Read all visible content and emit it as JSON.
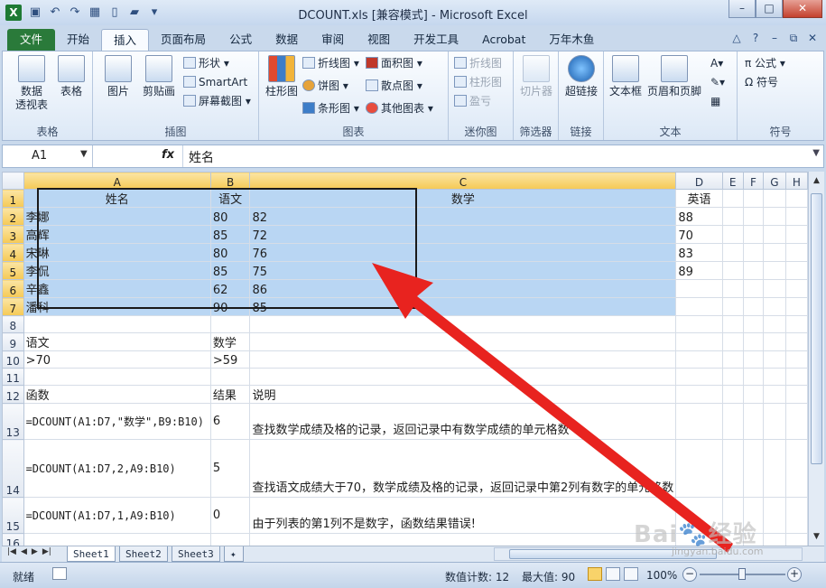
{
  "window": {
    "title": "DCOUNT.xls  [兼容模式] - Microsoft Excel",
    "app_icon": "X"
  },
  "quick_access": {
    "icons": [
      "save-icon",
      "undo-icon",
      "redo-icon",
      "save-icon",
      "new-icon",
      "open-icon",
      "customize-icon"
    ]
  },
  "ribbon_tabs": [
    {
      "label": "文件",
      "key": "file"
    },
    {
      "label": "开始",
      "key": "home"
    },
    {
      "label": "插入",
      "key": "insert"
    },
    {
      "label": "页面布局",
      "key": "page-layout"
    },
    {
      "label": "公式",
      "key": "formulas"
    },
    {
      "label": "数据",
      "key": "data"
    },
    {
      "label": "审阅",
      "key": "review"
    },
    {
      "label": "视图",
      "key": "view"
    },
    {
      "label": "开发工具",
      "key": "developer"
    },
    {
      "label": "Acrobat",
      "key": "acrobat"
    },
    {
      "label": "万年木鱼",
      "key": "custom"
    }
  ],
  "ribbon": {
    "groups": {
      "tables": "表格",
      "illustrations": "插图",
      "charts": "图表",
      "sparklines": "迷你图",
      "filter": "筛选器",
      "links": "链接",
      "text": "文本",
      "symbols": "符号"
    },
    "pivot_line1": "数据",
    "pivot_line2": "透视表",
    "table": "表格",
    "picture": "图片",
    "clipart": "剪贴画",
    "shapes": "形状",
    "smartart": "SmartArt",
    "screenshot": "屏幕截图",
    "column": "柱形图",
    "line": "折线图",
    "pie": "饼图",
    "bar": "条形图",
    "area": "面积图",
    "scatter": "散点图",
    "other_charts": "其他图表",
    "spark_line": "折线图",
    "spark_column": "柱形图",
    "spark_winloss": "盈亏",
    "slicer": "切片器",
    "hyperlink": "超链接",
    "textbox": "文本框",
    "header_footer": "页眉和页脚",
    "equation": "公式",
    "symbol": "符号"
  },
  "formula_bar": {
    "name_box": "A1",
    "fx": "fx",
    "value": "姓名"
  },
  "columns": [
    "A",
    "B",
    "C",
    "D",
    "E",
    "F",
    "G",
    "H"
  ],
  "rows": [
    {
      "num": "1",
      "cells": [
        "姓名",
        "语文",
        "数学",
        "英语",
        "",
        "",
        "",
        ""
      ]
    },
    {
      "num": "2",
      "cells": [
        "李娜",
        "80",
        "82",
        "88",
        "",
        "",
        "",
        ""
      ]
    },
    {
      "num": "3",
      "cells": [
        "高辉",
        "85",
        "72",
        "70",
        "",
        "",
        "",
        ""
      ]
    },
    {
      "num": "4",
      "cells": [
        "宋琳",
        "80",
        "76",
        "83",
        "",
        "",
        "",
        ""
      ]
    },
    {
      "num": "5",
      "cells": [
        "李侃",
        "85",
        "75",
        "89",
        "",
        "",
        "",
        ""
      ]
    },
    {
      "num": "6",
      "cells": [
        "辛鑫",
        "62",
        "86",
        "",
        "",
        "",
        "",
        ""
      ]
    },
    {
      "num": "7",
      "cells": [
        "潘科",
        "90",
        "85",
        "",
        "",
        "",
        "",
        ""
      ]
    },
    {
      "num": "8",
      "cells": [
        "",
        "",
        "",
        "",
        "",
        "",
        "",
        ""
      ]
    },
    {
      "num": "9",
      "cells": [
        "语文",
        "数学",
        "",
        "",
        "",
        "",
        "",
        ""
      ]
    },
    {
      "num": "10",
      "cells": [
        ">70",
        ">59",
        "",
        "",
        "",
        "",
        "",
        ""
      ]
    },
    {
      "num": "11",
      "cells": [
        "",
        "",
        "",
        "",
        "",
        "",
        "",
        ""
      ]
    },
    {
      "num": "12",
      "cells": [
        "函数",
        "结果",
        "说明",
        "",
        "",
        "",
        "",
        ""
      ]
    },
    {
      "num": "13",
      "cells": [
        "=DCOUNT(A1:D7,\"数学\",B9:B10)",
        "6",
        "查找数学成绩及格的记录，返回记录中有数学成绩的单元格数",
        "",
        "",
        "",
        "",
        ""
      ]
    },
    {
      "num": "14",
      "cells": [
        "=DCOUNT(A1:D7,2,A9:B10)",
        "5",
        "查找语文成绩大于70，数学成绩及格的记录，返回记录中第2列有数字的单元格数",
        "",
        "",
        "",
        "",
        ""
      ]
    },
    {
      "num": "15",
      "cells": [
        "=DCOUNT(A1:D7,1,A9:B10)",
        "0",
        "由于列表的第1列不是数字，函数结果错误!",
        "",
        "",
        "",
        "",
        ""
      ]
    },
    {
      "num": "16",
      "cells": [
        "",
        "",
        "",
        "",
        "",
        "",
        "",
        ""
      ]
    }
  ],
  "sheet_tabs": [
    "Sheet1",
    "Sheet2",
    "Sheet3"
  ],
  "status": {
    "ready": "就绪",
    "count": "数值计数: 12",
    "max": "最大值: 90",
    "zoom": "100%"
  },
  "watermark": {
    "text": "Bai 经验",
    "url": "jingyan.baidu.com"
  },
  "annotation": {
    "color": "#e8231f"
  }
}
